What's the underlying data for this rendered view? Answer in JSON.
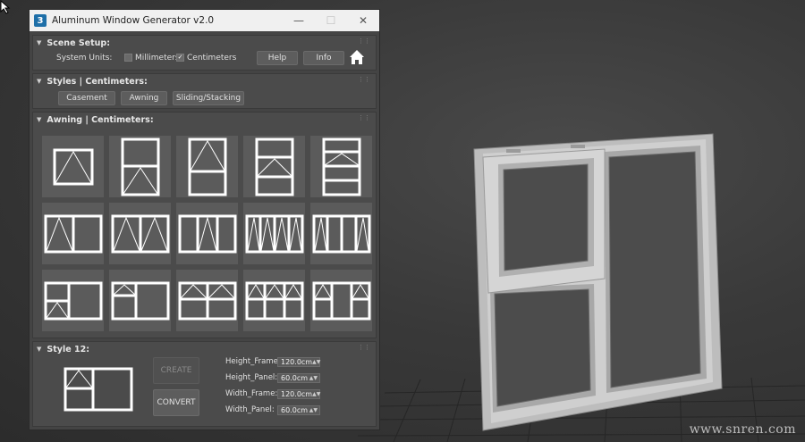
{
  "window": {
    "title": "Aluminum Window Generator v2.0",
    "app_icon_glyph": "3",
    "controls": [
      "minimize-icon",
      "maximize-icon",
      "close-icon"
    ]
  },
  "scene_setup": {
    "header": "Scene Setup:",
    "units_label": "System Units:",
    "millimeters_label": "Millimeters",
    "millimeters_checked": false,
    "centimeters_label": "Centimeters",
    "centimeters_checked": true,
    "help_label": "Help",
    "info_label": "Info",
    "home_icon": "home-icon"
  },
  "styles": {
    "header": "Styles | Centimeters:",
    "buttons": [
      "Casement",
      "Awning",
      "Sliding/Stacking"
    ]
  },
  "awning": {
    "header": "Awning | Centimeters:",
    "thumbnail_count": 15
  },
  "style12": {
    "header": "Style 12:",
    "create_label": "CREATE",
    "create_enabled": false,
    "convert_label": "CONVERT",
    "params": [
      {
        "label": "Height_Frame:",
        "value": "120.0cm"
      },
      {
        "label": "Height_Panel:",
        "value": "60.0cm"
      },
      {
        "label": "Width_Frame:",
        "value": "120.0cm"
      },
      {
        "label": "Width_Panel:",
        "value": "60.0cm"
      }
    ]
  },
  "watermark": "www.snren.com",
  "colors": {
    "viewport_bg": "#3a3a3a",
    "panel_bg": "#444444",
    "thumb_bg": "#5b5b5b",
    "frame_white": "#ffffff",
    "model_frame": "#c9c9c9",
    "model_glass": "#4c4c4c"
  }
}
